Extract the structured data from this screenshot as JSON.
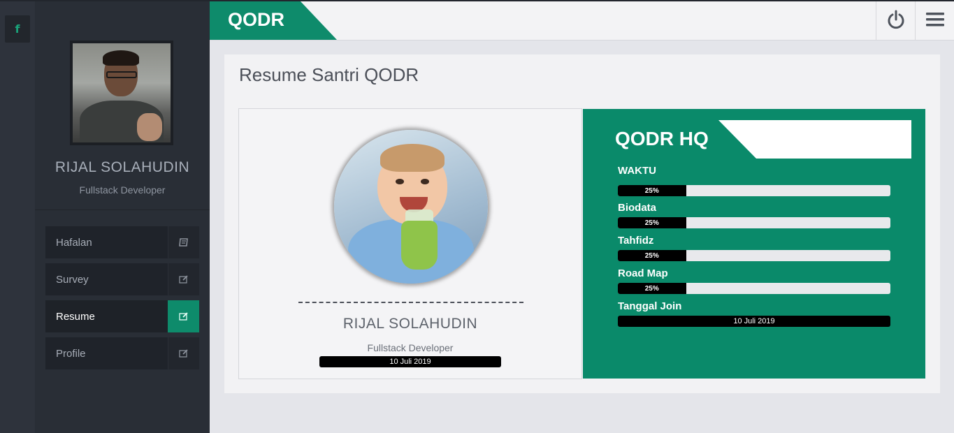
{
  "app": {
    "brand": "QODR"
  },
  "rail": {
    "social_icon": "facebook-icon",
    "social_glyph": "f"
  },
  "sidebar": {
    "user_name": "RIJAL SOLAHUDIN",
    "user_role": "Fullstack Developer",
    "items": [
      {
        "label": "Hafalan",
        "icon": "book-icon",
        "active": false
      },
      {
        "label": "Survey",
        "icon": "edit-icon",
        "active": false
      },
      {
        "label": "Resume",
        "icon": "edit-icon",
        "active": true
      },
      {
        "label": "Profile",
        "icon": "edit-icon",
        "active": false
      }
    ]
  },
  "topbar": {
    "power_icon": "power-icon",
    "menu_icon": "hamburger-menu-icon"
  },
  "main": {
    "title": "Resume Santri QODR",
    "profile": {
      "name": "RIJAL SOLAHUDIN",
      "role": "Fullstack Developer",
      "date": "10 Juli 2019"
    },
    "hq": {
      "title": "QODR HQ",
      "stats": [
        {
          "label": "WAKTU",
          "progress_percent": 25,
          "text": "25%"
        },
        {
          "label": "Biodata",
          "progress_percent": 25,
          "text": "25%"
        },
        {
          "label": "Tahfidz",
          "progress_percent": 25,
          "text": "25%"
        },
        {
          "label": "Road Map",
          "progress_percent": 25,
          "text": "25%"
        }
      ],
      "join_label": "Tanggal Join",
      "join_date": "10 Juli 2019"
    }
  },
  "colors": {
    "accent": "#0e8b6b",
    "sidebar_bg": "#292e36",
    "rail_bg": "#2e333c",
    "panel_bg": "#f2f2f4"
  }
}
